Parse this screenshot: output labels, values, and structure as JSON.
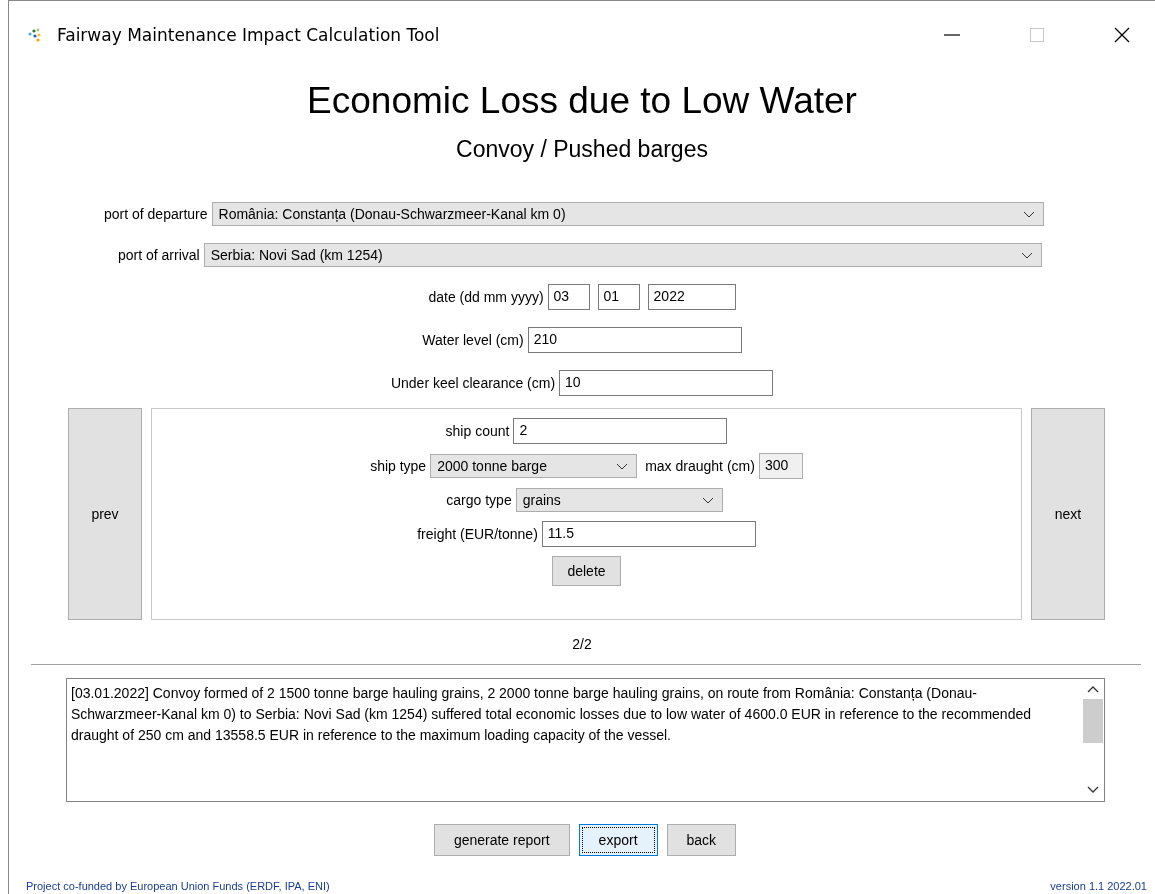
{
  "window": {
    "title": "Fairway Maintenance Impact Calculation Tool"
  },
  "heading": "Economic Loss due to Low Water",
  "subheading": "Convoy / Pushed barges",
  "route": [
    {
      "label": "port of departure",
      "value": "România: Constanța (Donau-Schwarzmeer-Kanal km 0)"
    },
    {
      "label": "port of arrival",
      "value": "Serbia: Novi Sad (km 1254)"
    }
  ],
  "date": {
    "label": "date (dd mm yyyy)",
    "day": "03",
    "month": "01",
    "year": "2022"
  },
  "water_level": {
    "label": "Water level (cm)",
    "value": "210"
  },
  "under_keel_clearance": {
    "label": "Under keel clearance (cm)",
    "value": "10"
  },
  "ship_panel": {
    "prev": "prev",
    "next": "next",
    "page": "2/2",
    "fields": [
      {
        "kind": "text",
        "label": "ship count",
        "value": "2"
      },
      {
        "kind": "select",
        "label": "ship type",
        "value": "2000 tonne barge",
        "extra_label": "max draught (cm)",
        "extra_value": "300"
      },
      {
        "kind": "select",
        "label": "cargo type",
        "value": "grains"
      },
      {
        "kind": "text",
        "label": "freight (EUR/tonne)",
        "value": "11.5"
      }
    ],
    "delete": "delete"
  },
  "report_text": "[03.01.2022] Convoy formed of 2 1500 tonne barge hauling grains, 2 2000 tonne barge hauling grains, on route from România: Constanța (Donau-Schwarzmeer-Kanal km 0) to Serbia: Novi Sad (km 1254) suffered total economic losses due to low water of 4600.0 EUR in reference to the recommended draught of 250 cm and 13558.5 EUR in reference to the maximum loading capacity of the vessel.",
  "actions": [
    {
      "label": "generate report",
      "focused": false
    },
    {
      "label": "export",
      "focused": true
    },
    {
      "label": "back",
      "focused": false
    }
  ],
  "footer": {
    "credit": "Project co-funded by European Union Funds (ERDF, IPA, ENI)",
    "version": "version 1.1 2022.01"
  }
}
